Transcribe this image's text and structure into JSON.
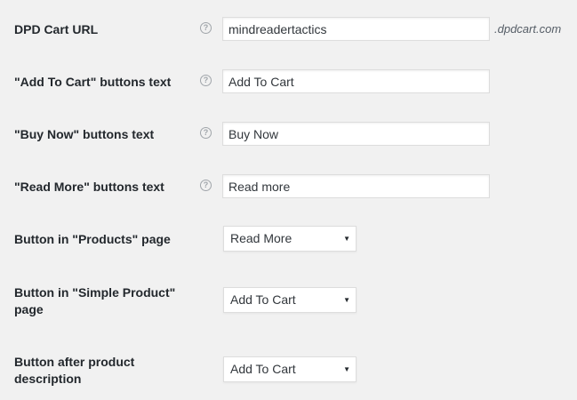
{
  "settings": {
    "dpd_cart_url": {
      "label": "DPD Cart URL",
      "value": "mindreadertactics",
      "suffix": ".dpdcart.com",
      "help_icon": "question-mark-circle"
    },
    "add_to_cart_text": {
      "label": "\"Add To Cart\" buttons text",
      "value": "Add To Cart",
      "help_icon": "question-mark-circle"
    },
    "buy_now_text": {
      "label": "\"Buy Now\" buttons text",
      "value": "Buy Now",
      "help_icon": "question-mark-circle"
    },
    "read_more_text": {
      "label": "\"Read More\" buttons text",
      "value": "Read more",
      "help_icon": "question-mark-circle"
    },
    "products_page_button": {
      "label": "Button in \"Products\" page",
      "selected": "Read More"
    },
    "simple_product_button": {
      "label": "Button in \"Simple Product\" page",
      "selected": "Add To Cart"
    },
    "after_description_button": {
      "label": "Button after product description",
      "selected": "Add To Cart"
    }
  },
  "colors": {
    "background": "#f1f1f1",
    "label_text": "#23282d",
    "input_border": "#dddddd",
    "help_icon": "#a0a5aa"
  }
}
